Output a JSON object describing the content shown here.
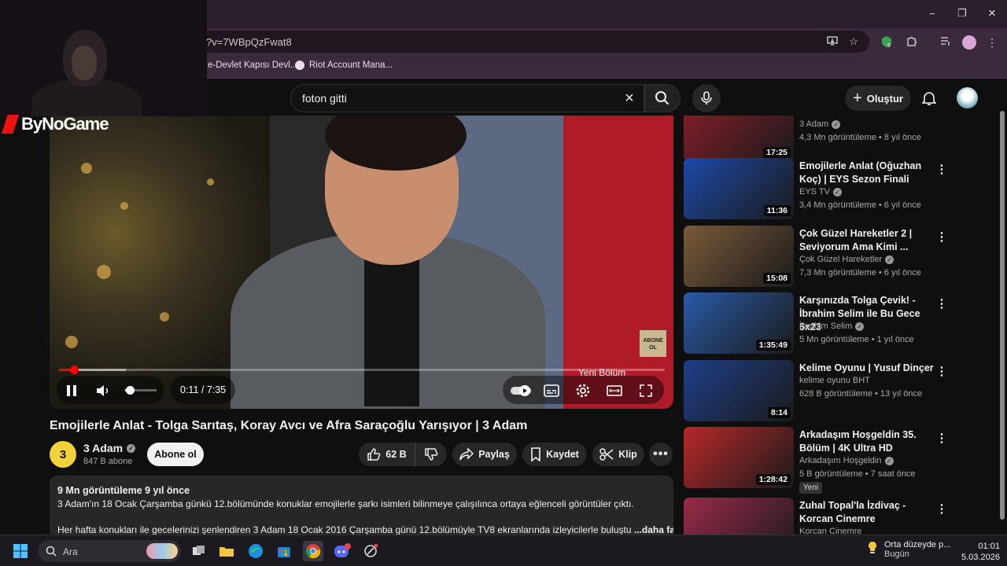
{
  "browser": {
    "url_fragment": "?v=7WBpQzFwat8",
    "bookmarks": [
      "e-Devlet Kapısı Devl...",
      "Riot Account Mana..."
    ],
    "extension_badge": "9",
    "window_controls": {
      "minimize": "−",
      "maximize": "❐",
      "close": "✕"
    }
  },
  "header": {
    "search_value": "foton gitti",
    "create_label": "Oluştur"
  },
  "overlay": {
    "logo_text": "ByNoGame"
  },
  "player": {
    "time": "0:11 / 7:35",
    "progress_fraction": 0.025,
    "buffer_fraction": 0.11,
    "volume_fraction": 0.15,
    "badge_text": "ABONE OL",
    "next_episode_text": "Yeni Bölüm"
  },
  "video": {
    "title": "Emojilerle Anlat - Tolga Sarıtaş, Koray Avcı ve Afra Saraçoğlu Yarışıyor | 3 Adam",
    "channel_name": "3 Adam",
    "channel_avatar_text": "3",
    "subscribers": "847 B abone",
    "subscribe_label": "Abone ol",
    "likes": "62 B",
    "share_label": "Paylaş",
    "save_label": "Kaydet",
    "clip_label": "Klip",
    "views_date": "9 Mn görüntüleme  9 yıl önce",
    "desc_line1": "3 Adam'ın 18 Ocak Çarşamba günkü 12.bölümünde konuklar emojilerle şarkı isimleri bilinmeye çalışılınca ortaya eğlenceli görüntüler çıktı.",
    "desc_line2": "Her hafta konukları ile gecelerinizi şenlendiren 3 Adam 18 Ocak 2016 Çarşamba günü 12.bölümüyle TV8 ekranlarında izleyicilerle buluştu",
    "desc_more": "...daha fazla"
  },
  "sidebar": {
    "items": [
      {
        "title": "",
        "channel": "3 Adam",
        "stats": "4,3 Mn görüntüleme • 8 yıl önce",
        "duration": "17:25",
        "verified": true,
        "thumb_color": "#8a1e2a"
      },
      {
        "title": "Emojilerle Anlat (Oğuzhan Koç) | EYS Sezon Finali",
        "channel": "EYS TV",
        "stats": "3,4 Mn görüntüleme • 6 yıl önce",
        "duration": "11:36",
        "verified": true,
        "thumb_color": "#1d49a8"
      },
      {
        "title": "Çok Güzel Hareketler 2 | Seviyorum Ama Kimi ...",
        "channel": "Çok Güzel Hareketler",
        "stats": "7,3 Mn görüntüleme • 6 yıl önce",
        "duration": "15:08",
        "verified": true,
        "thumb_color": "#7a5a3a"
      },
      {
        "title": "Karşınızda Tolga Çevik! - İbrahim Selim ile Bu Gece 5x23",
        "channel": "İbrahim Selim",
        "stats": "5 Mn görüntüleme • 1 yıl önce",
        "duration": "1:35:49",
        "verified": true,
        "thumb_color": "#2a5aa8"
      },
      {
        "title": "Kelime Oyunu | Yusuf Dinçer",
        "channel": "kelime oyunu BHT",
        "stats": "628 B görüntüleme • 13 yıl önce",
        "duration": "8:14",
        "verified": false,
        "thumb_color": "#1e3e8a"
      },
      {
        "title": "Arkadaşım Hoşgeldin 35. Bölüm | 4K Ultra HD",
        "channel": "Arkadaşım Hoşgeldin",
        "stats": "5 B görüntüleme • 7 saat önce",
        "duration": "1:28:42",
        "verified": true,
        "badge": "Yeni",
        "thumb_color": "#b8282a"
      },
      {
        "title": "Zuhal Topal'la İzdivaç - Korcan Cinemre",
        "channel": "Korcan Cinemre",
        "stats": "",
        "duration": "",
        "verified": false,
        "thumb_color": "#9a2a4a"
      }
    ]
  },
  "taskbar": {
    "search_placeholder": "Ara",
    "weather_line1": "Orta düzeyde p...",
    "weather_line2": "Bugün",
    "time": "01:01",
    "date": "5.03.2026"
  },
  "colors": {
    "accent_red": "#ff0000",
    "background": "#0f0f0f",
    "pill": "#272727"
  }
}
